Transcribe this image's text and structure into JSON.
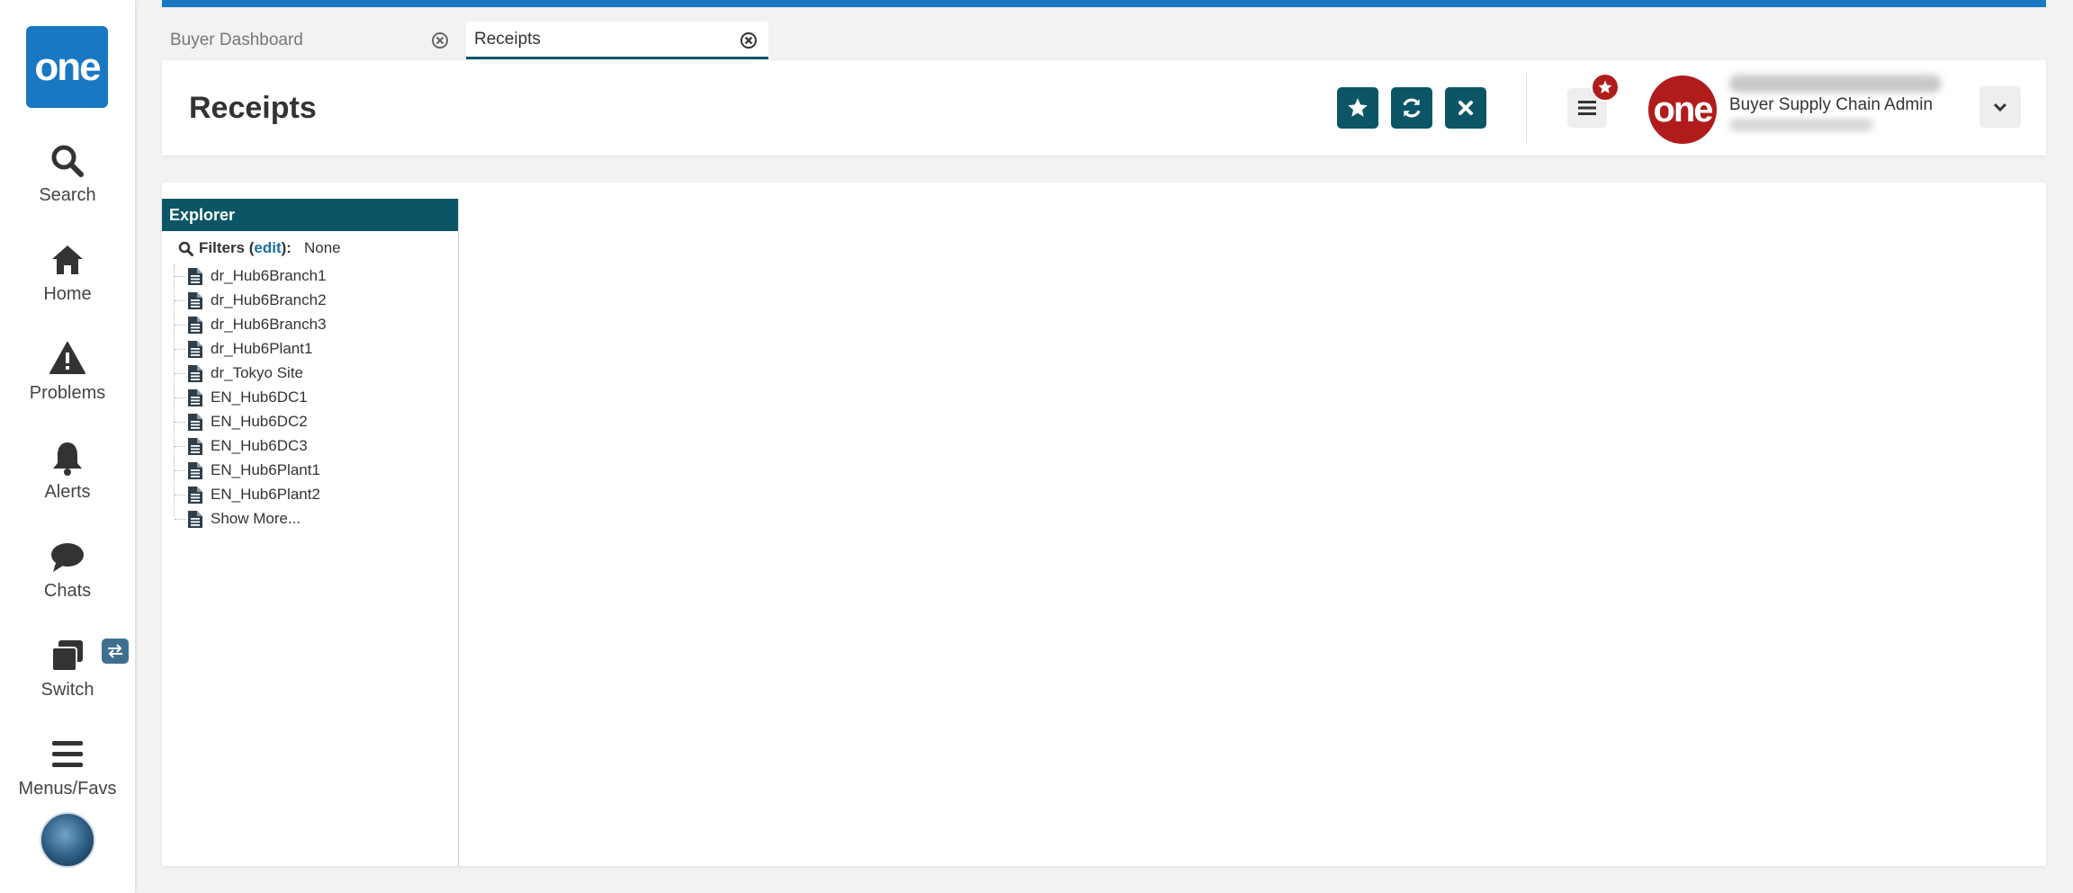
{
  "nav": {
    "logo_text": "one",
    "items": [
      {
        "label": "Search",
        "icon": "search-icon"
      },
      {
        "label": "Home",
        "icon": "home-icon"
      },
      {
        "label": "Problems",
        "icon": "warning-icon"
      },
      {
        "label": "Alerts",
        "icon": "bell-icon"
      },
      {
        "label": "Chats",
        "icon": "chat-icon"
      },
      {
        "label": "Switch",
        "icon": "switch-icon"
      },
      {
        "label": "Menus/Favs",
        "icon": "menu-icon"
      }
    ]
  },
  "tabs": [
    {
      "label": "Buyer Dashboard",
      "active": false
    },
    {
      "label": "Receipts",
      "active": true
    }
  ],
  "header": {
    "title": "Receipts",
    "actions": [
      "star-icon",
      "refresh-icon",
      "close-icon"
    ],
    "user": {
      "avatar_text": "one",
      "role": "Buyer Supply Chain Admin"
    }
  },
  "explorer": {
    "title": "Explorer",
    "filters_label": "Filters (",
    "filters_edit": "edit",
    "filters_suffix": "):",
    "filters_value": "None",
    "items": [
      "dr_Hub6Branch1",
      "dr_Hub6Branch2",
      "dr_Hub6Branch3",
      "dr_Hub6Plant1",
      "dr_Tokyo Site",
      "EN_Hub6DC1",
      "EN_Hub6DC2",
      "EN_Hub6DC3",
      "EN_Hub6Plant1",
      "EN_Hub6Plant2",
      "Show More..."
    ]
  },
  "colors": {
    "brand_blue": "#1a78c2",
    "teal": "#0b5566",
    "red": "#b01c1c"
  }
}
